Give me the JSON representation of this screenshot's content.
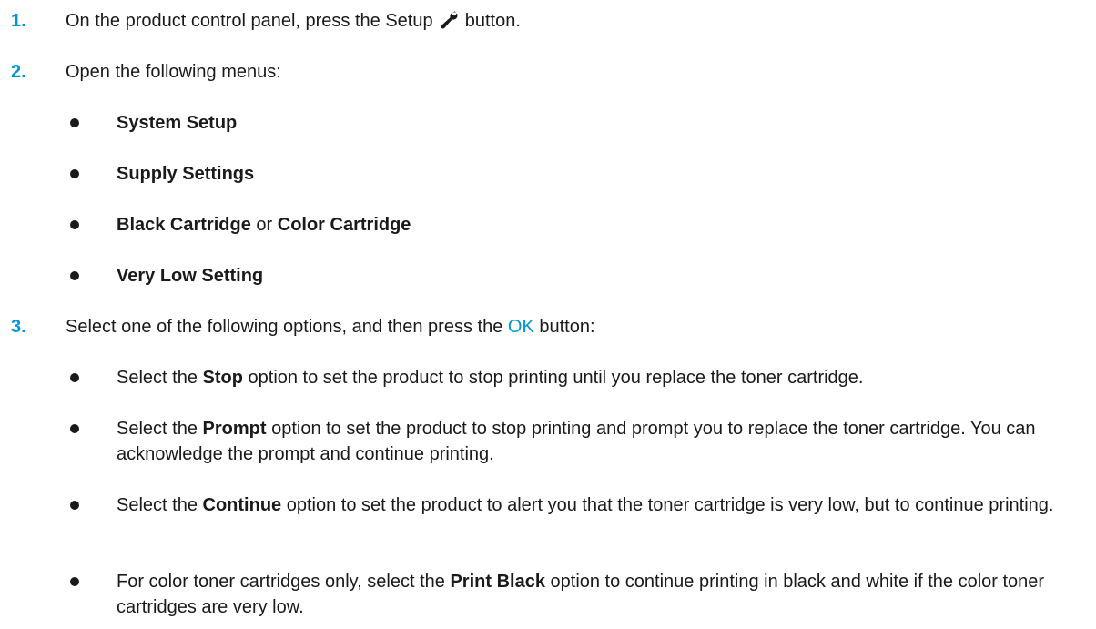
{
  "colors": {
    "accent": "#0096d6",
    "text": "#1a1a1a"
  },
  "steps": [
    {
      "num": "1.",
      "text_before": "On the product control panel, press the Setup",
      "icon": "wrench-icon",
      "text_after": "button."
    },
    {
      "num": "2.",
      "text": "Open the following menus:",
      "menus": [
        {
          "parts": [
            {
              "text": "System Setup",
              "bold": true
            }
          ]
        },
        {
          "parts": [
            {
              "text": "Supply Settings",
              "bold": true
            }
          ]
        },
        {
          "parts": [
            {
              "text": "Black Cartridge",
              "bold": true
            },
            {
              "text": " or ",
              "bold": false
            },
            {
              "text": "Color Cartridge",
              "bold": true
            }
          ]
        },
        {
          "parts": [
            {
              "text": "Very Low Setting",
              "bold": true
            }
          ]
        }
      ]
    },
    {
      "num": "3.",
      "text_before": "Select one of the following options, and then press the",
      "button_label": "OK",
      "text_after": "button:",
      "options": [
        {
          "pre": "Select the ",
          "bold": "Stop",
          "post": " option to set the product to stop printing until you replace the toner cartridge."
        },
        {
          "pre": "Select the ",
          "bold": "Prompt",
          "post": " option to set the product to stop printing and prompt you to replace the toner cartridge. You can acknowledge the prompt and continue printing."
        },
        {
          "pre": "Select the ",
          "bold": "Continue",
          "post": " option to set the product to alert you that the toner cartridge is very low, but to continue printing."
        },
        {
          "pre": "For color toner cartridges only, select the ",
          "bold": "Print Black",
          "post": " option to continue printing in black and white if the color toner cartridges are very low."
        }
      ]
    }
  ]
}
